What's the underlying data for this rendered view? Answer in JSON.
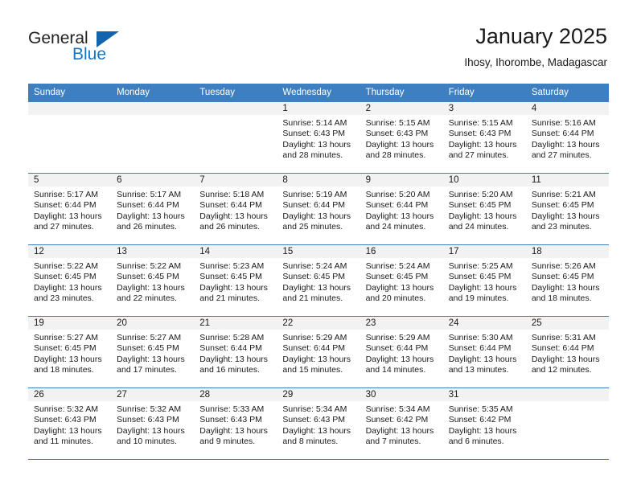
{
  "brand": {
    "name_part1": "General",
    "name_part2": "Blue",
    "accent_color": "#1277c4",
    "triangle_color": "#1164ad"
  },
  "header": {
    "title": "January 2025",
    "subtitle": "Ihosy, Ihorombe, Madagascar"
  },
  "theme": {
    "header_row_color": "#3d7fc1",
    "daynum_bg": "#f2f2f2",
    "text_color": "#1a1a1a"
  },
  "calendar": {
    "day_headers": [
      "Sunday",
      "Monday",
      "Tuesday",
      "Wednesday",
      "Thursday",
      "Friday",
      "Saturday"
    ],
    "weeks": [
      [
        {
          "day": "",
          "sunrise": "",
          "sunset": "",
          "daylight_line1": "",
          "daylight_line2": ""
        },
        {
          "day": "",
          "sunrise": "",
          "sunset": "",
          "daylight_line1": "",
          "daylight_line2": ""
        },
        {
          "day": "",
          "sunrise": "",
          "sunset": "",
          "daylight_line1": "",
          "daylight_line2": ""
        },
        {
          "day": "1",
          "sunrise": "Sunrise: 5:14 AM",
          "sunset": "Sunset: 6:43 PM",
          "daylight_line1": "Daylight: 13 hours",
          "daylight_line2": "and 28 minutes."
        },
        {
          "day": "2",
          "sunrise": "Sunrise: 5:15 AM",
          "sunset": "Sunset: 6:43 PM",
          "daylight_line1": "Daylight: 13 hours",
          "daylight_line2": "and 28 minutes."
        },
        {
          "day": "3",
          "sunrise": "Sunrise: 5:15 AM",
          "sunset": "Sunset: 6:43 PM",
          "daylight_line1": "Daylight: 13 hours",
          "daylight_line2": "and 27 minutes."
        },
        {
          "day": "4",
          "sunrise": "Sunrise: 5:16 AM",
          "sunset": "Sunset: 6:44 PM",
          "daylight_line1": "Daylight: 13 hours",
          "daylight_line2": "and 27 minutes."
        }
      ],
      [
        {
          "day": "5",
          "sunrise": "Sunrise: 5:17 AM",
          "sunset": "Sunset: 6:44 PM",
          "daylight_line1": "Daylight: 13 hours",
          "daylight_line2": "and 27 minutes."
        },
        {
          "day": "6",
          "sunrise": "Sunrise: 5:17 AM",
          "sunset": "Sunset: 6:44 PM",
          "daylight_line1": "Daylight: 13 hours",
          "daylight_line2": "and 26 minutes."
        },
        {
          "day": "7",
          "sunrise": "Sunrise: 5:18 AM",
          "sunset": "Sunset: 6:44 PM",
          "daylight_line1": "Daylight: 13 hours",
          "daylight_line2": "and 26 minutes."
        },
        {
          "day": "8",
          "sunrise": "Sunrise: 5:19 AM",
          "sunset": "Sunset: 6:44 PM",
          "daylight_line1": "Daylight: 13 hours",
          "daylight_line2": "and 25 minutes."
        },
        {
          "day": "9",
          "sunrise": "Sunrise: 5:20 AM",
          "sunset": "Sunset: 6:44 PM",
          "daylight_line1": "Daylight: 13 hours",
          "daylight_line2": "and 24 minutes."
        },
        {
          "day": "10",
          "sunrise": "Sunrise: 5:20 AM",
          "sunset": "Sunset: 6:45 PM",
          "daylight_line1": "Daylight: 13 hours",
          "daylight_line2": "and 24 minutes."
        },
        {
          "day": "11",
          "sunrise": "Sunrise: 5:21 AM",
          "sunset": "Sunset: 6:45 PM",
          "daylight_line1": "Daylight: 13 hours",
          "daylight_line2": "and 23 minutes."
        }
      ],
      [
        {
          "day": "12",
          "sunrise": "Sunrise: 5:22 AM",
          "sunset": "Sunset: 6:45 PM",
          "daylight_line1": "Daylight: 13 hours",
          "daylight_line2": "and 23 minutes."
        },
        {
          "day": "13",
          "sunrise": "Sunrise: 5:22 AM",
          "sunset": "Sunset: 6:45 PM",
          "daylight_line1": "Daylight: 13 hours",
          "daylight_line2": "and 22 minutes."
        },
        {
          "day": "14",
          "sunrise": "Sunrise: 5:23 AM",
          "sunset": "Sunset: 6:45 PM",
          "daylight_line1": "Daylight: 13 hours",
          "daylight_line2": "and 21 minutes."
        },
        {
          "day": "15",
          "sunrise": "Sunrise: 5:24 AM",
          "sunset": "Sunset: 6:45 PM",
          "daylight_line1": "Daylight: 13 hours",
          "daylight_line2": "and 21 minutes."
        },
        {
          "day": "16",
          "sunrise": "Sunrise: 5:24 AM",
          "sunset": "Sunset: 6:45 PM",
          "daylight_line1": "Daylight: 13 hours",
          "daylight_line2": "and 20 minutes."
        },
        {
          "day": "17",
          "sunrise": "Sunrise: 5:25 AM",
          "sunset": "Sunset: 6:45 PM",
          "daylight_line1": "Daylight: 13 hours",
          "daylight_line2": "and 19 minutes."
        },
        {
          "day": "18",
          "sunrise": "Sunrise: 5:26 AM",
          "sunset": "Sunset: 6:45 PM",
          "daylight_line1": "Daylight: 13 hours",
          "daylight_line2": "and 18 minutes."
        }
      ],
      [
        {
          "day": "19",
          "sunrise": "Sunrise: 5:27 AM",
          "sunset": "Sunset: 6:45 PM",
          "daylight_line1": "Daylight: 13 hours",
          "daylight_line2": "and 18 minutes."
        },
        {
          "day": "20",
          "sunrise": "Sunrise: 5:27 AM",
          "sunset": "Sunset: 6:45 PM",
          "daylight_line1": "Daylight: 13 hours",
          "daylight_line2": "and 17 minutes."
        },
        {
          "day": "21",
          "sunrise": "Sunrise: 5:28 AM",
          "sunset": "Sunset: 6:44 PM",
          "daylight_line1": "Daylight: 13 hours",
          "daylight_line2": "and 16 minutes."
        },
        {
          "day": "22",
          "sunrise": "Sunrise: 5:29 AM",
          "sunset": "Sunset: 6:44 PM",
          "daylight_line1": "Daylight: 13 hours",
          "daylight_line2": "and 15 minutes."
        },
        {
          "day": "23",
          "sunrise": "Sunrise: 5:29 AM",
          "sunset": "Sunset: 6:44 PM",
          "daylight_line1": "Daylight: 13 hours",
          "daylight_line2": "and 14 minutes."
        },
        {
          "day": "24",
          "sunrise": "Sunrise: 5:30 AM",
          "sunset": "Sunset: 6:44 PM",
          "daylight_line1": "Daylight: 13 hours",
          "daylight_line2": "and 13 minutes."
        },
        {
          "day": "25",
          "sunrise": "Sunrise: 5:31 AM",
          "sunset": "Sunset: 6:44 PM",
          "daylight_line1": "Daylight: 13 hours",
          "daylight_line2": "and 12 minutes."
        }
      ],
      [
        {
          "day": "26",
          "sunrise": "Sunrise: 5:32 AM",
          "sunset": "Sunset: 6:43 PM",
          "daylight_line1": "Daylight: 13 hours",
          "daylight_line2": "and 11 minutes."
        },
        {
          "day": "27",
          "sunrise": "Sunrise: 5:32 AM",
          "sunset": "Sunset: 6:43 PM",
          "daylight_line1": "Daylight: 13 hours",
          "daylight_line2": "and 10 minutes."
        },
        {
          "day": "28",
          "sunrise": "Sunrise: 5:33 AM",
          "sunset": "Sunset: 6:43 PM",
          "daylight_line1": "Daylight: 13 hours",
          "daylight_line2": "and 9 minutes."
        },
        {
          "day": "29",
          "sunrise": "Sunrise: 5:34 AM",
          "sunset": "Sunset: 6:43 PM",
          "daylight_line1": "Daylight: 13 hours",
          "daylight_line2": "and 8 minutes."
        },
        {
          "day": "30",
          "sunrise": "Sunrise: 5:34 AM",
          "sunset": "Sunset: 6:42 PM",
          "daylight_line1": "Daylight: 13 hours",
          "daylight_line2": "and 7 minutes."
        },
        {
          "day": "31",
          "sunrise": "Sunrise: 5:35 AM",
          "sunset": "Sunset: 6:42 PM",
          "daylight_line1": "Daylight: 13 hours",
          "daylight_line2": "and 6 minutes."
        },
        {
          "day": "",
          "sunrise": "",
          "sunset": "",
          "daylight_line1": "",
          "daylight_line2": ""
        }
      ]
    ]
  }
}
